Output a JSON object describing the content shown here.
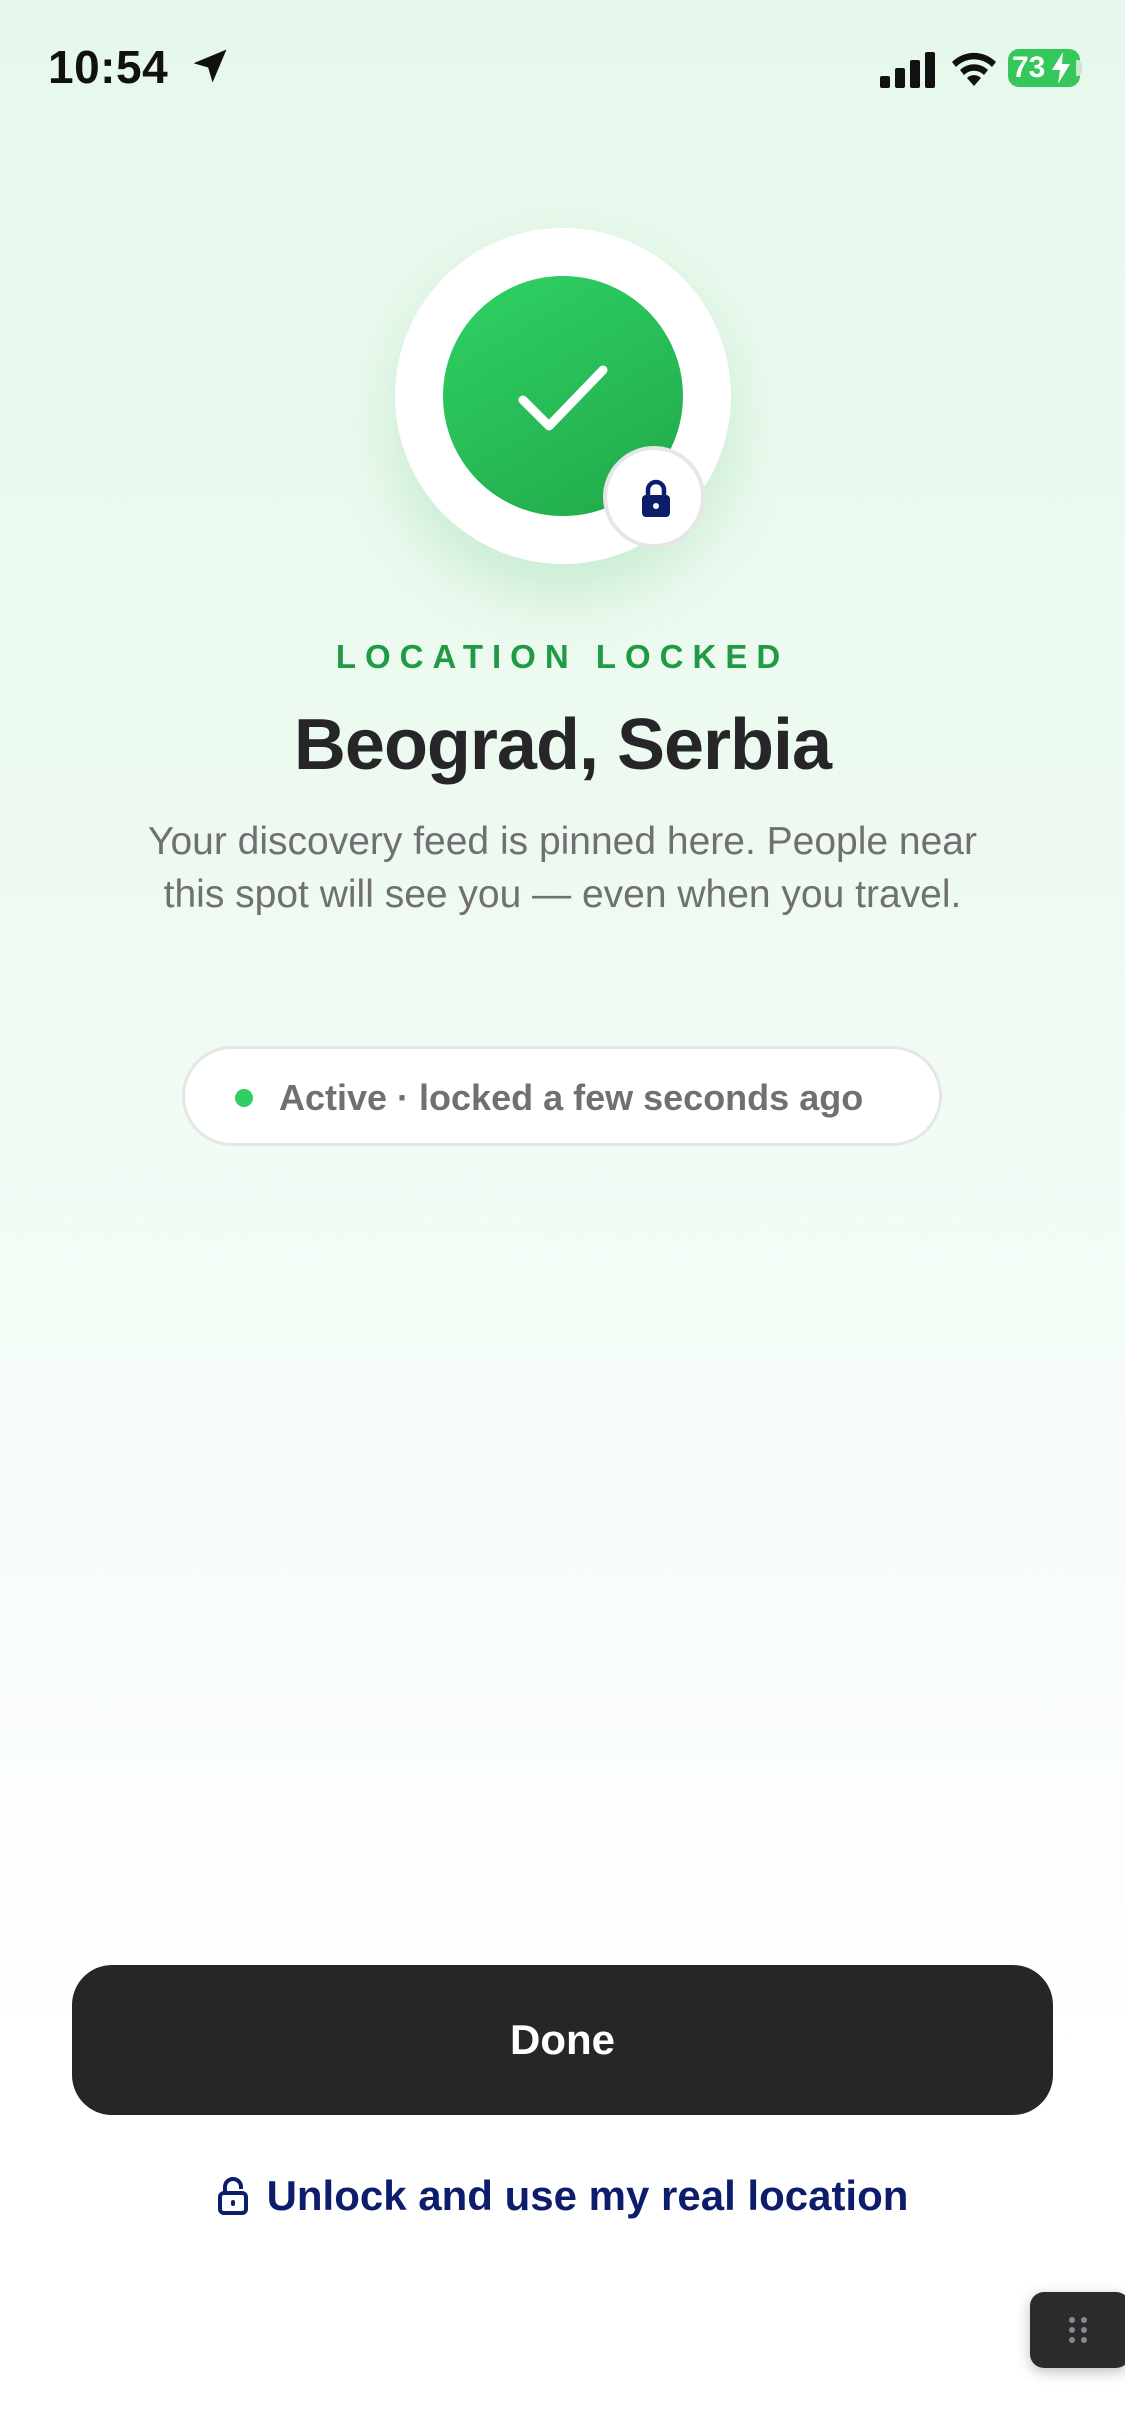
{
  "status_bar": {
    "time": "10:54",
    "battery_level": "73",
    "icons": [
      "location-arrow-icon",
      "cellular-signal-icon",
      "wifi-icon",
      "battery-charging-icon"
    ]
  },
  "hero": {
    "icon": "checkmark-icon",
    "badge_icon": "lock-icon",
    "accent_color": "#22b14f"
  },
  "content": {
    "eyebrow": "LOCATION LOCKED",
    "title": "Beograd, Serbia",
    "subtitle": "Your discovery feed is pinned here. People near this spot will see you — even when you travel."
  },
  "status_pill": {
    "text": "Active · locked a few seconds ago",
    "dot_color": "#2fcf63"
  },
  "actions": {
    "done_label": "Done",
    "unlock_label": "Unlock and use my real location",
    "unlock_icon": "lock-open-icon",
    "unlock_color": "#0d1d6b"
  },
  "floating_handle": {
    "icon": "drag-handle-icon"
  }
}
